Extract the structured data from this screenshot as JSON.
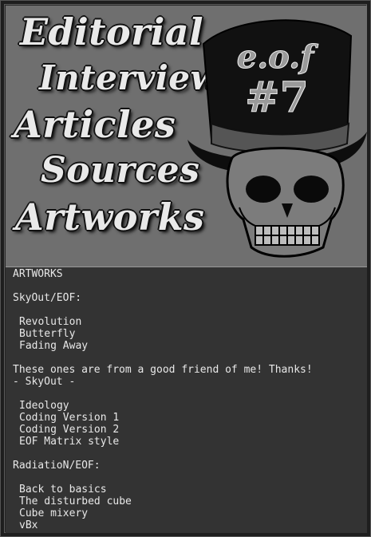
{
  "menu": {
    "items": [
      {
        "label": "Editorial"
      },
      {
        "label": "Interviews"
      },
      {
        "label": "Articles"
      },
      {
        "label": "Sources"
      },
      {
        "label": "Artworks"
      }
    ]
  },
  "logo": {
    "hat_text": "e.o.f",
    "hat_number": "#7",
    "icon": "skull-top-hat-logo"
  },
  "content": {
    "title": "ARTWORKS",
    "section1_heading": "SkyOut/EOF:",
    "section1_items": [
      "Revolution",
      "Butterfly",
      "Fading Away"
    ],
    "note_line1": "These ones are from a good friend of me! Thanks!",
    "note_line2": "- SkyOut -",
    "section2_items": [
      "Ideology",
      "Coding Version 1",
      "Coding Version 2",
      "EOF Matrix style"
    ],
    "section3_heading": "RadiatioN/EOF:",
    "section3_items": [
      "Back to basics",
      "The disturbed cube",
      "Cube mixery",
      "vBx"
    ]
  },
  "colors": {
    "header_bg": "#6f6f6f",
    "content_bg": "#333333",
    "text": "#e8e8e8"
  }
}
